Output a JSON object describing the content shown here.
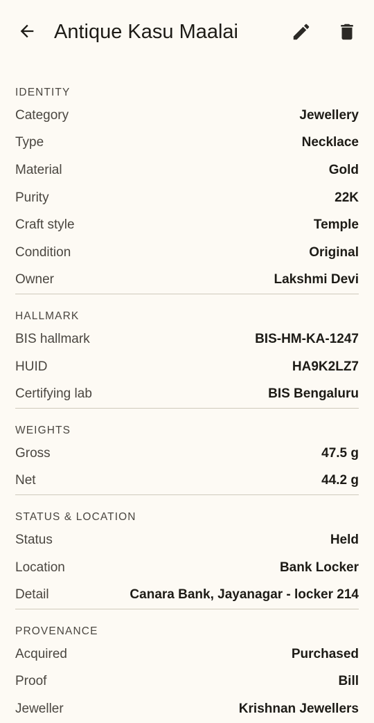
{
  "header": {
    "title": "Antique Kasu Maalai"
  },
  "sections": {
    "identity": {
      "title": "IDENTITY",
      "rows": [
        {
          "label": "Category",
          "value": "Jewellery"
        },
        {
          "label": "Type",
          "value": "Necklace"
        },
        {
          "label": "Material",
          "value": "Gold"
        },
        {
          "label": "Purity",
          "value": "22K"
        },
        {
          "label": "Craft style",
          "value": "Temple"
        },
        {
          "label": "Condition",
          "value": "Original"
        },
        {
          "label": "Owner",
          "value": "Lakshmi Devi"
        }
      ]
    },
    "hallmark": {
      "title": "HALLMARK",
      "rows": [
        {
          "label": "BIS hallmark",
          "value": "BIS-HM-KA-1247"
        },
        {
          "label": "HUID",
          "value": "HA9K2LZ7"
        },
        {
          "label": "Certifying lab",
          "value": "BIS Bengaluru"
        }
      ]
    },
    "weights": {
      "title": "WEIGHTS",
      "rows": [
        {
          "label": "Gross",
          "value": "47.5 g"
        },
        {
          "label": "Net",
          "value": "44.2 g"
        }
      ]
    },
    "status": {
      "title": "STATUS & LOCATION",
      "rows": [
        {
          "label": "Status",
          "value": "Held"
        },
        {
          "label": "Location",
          "value": "Bank Locker"
        },
        {
          "label": "Detail",
          "value": "Canara Bank, Jayanagar - locker 214"
        }
      ]
    },
    "provenance": {
      "title": "PROVENANCE",
      "rows": [
        {
          "label": "Acquired",
          "value": "Purchased"
        },
        {
          "label": "Proof",
          "value": "Bill"
        },
        {
          "label": "Jeweller",
          "value": "Krishnan Jewellers"
        }
      ]
    }
  },
  "icons": {
    "back": "arrow-back-icon",
    "edit": "pencil-icon",
    "delete": "trash-icon"
  }
}
